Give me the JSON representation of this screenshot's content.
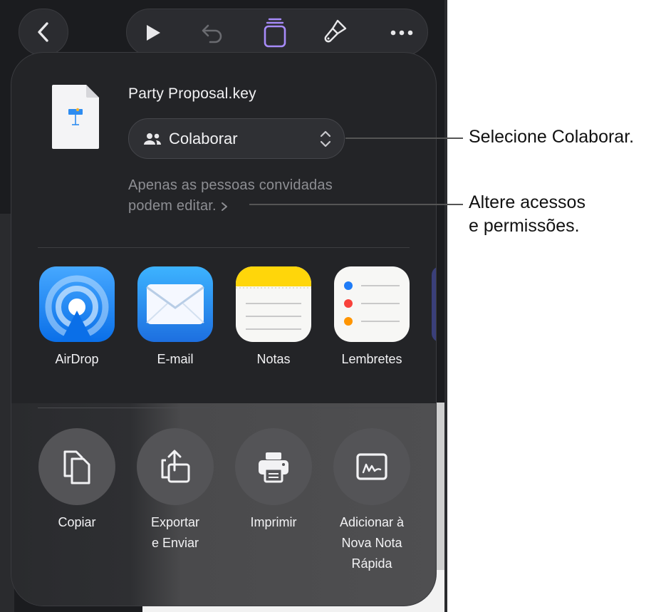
{
  "file": {
    "name": "Party Proposal.key"
  },
  "collaborate": {
    "label": "Colaborar"
  },
  "access": {
    "line1": "Apenas as pessoas convidadas",
    "line2": "podem editar."
  },
  "apps": [
    {
      "label": "AirDrop",
      "icon": "airdrop-icon"
    },
    {
      "label": "E-mail",
      "icon": "mail-icon"
    },
    {
      "label": "Notas",
      "icon": "notes-icon"
    },
    {
      "label": "Lembretes",
      "icon": "reminders-icon"
    }
  ],
  "actions": [
    {
      "line1": "Copiar",
      "line2": "",
      "line3": "",
      "icon": "copy-icon"
    },
    {
      "line1": "Exportar",
      "line2": "e Enviar",
      "line3": "",
      "icon": "export-icon"
    },
    {
      "line1": "Imprimir",
      "line2": "",
      "line3": "",
      "icon": "print-icon"
    },
    {
      "line1": "Adicionar à",
      "line2": "Nova Nota",
      "line3": "Rápida",
      "icon": "quick-note-icon"
    }
  ],
  "callouts": {
    "select_collaborate": "Selecione Colaborar.",
    "change_access_line1": "Altere acessos",
    "change_access_line2": "e permissões."
  },
  "colors": {
    "accent_purple": "#a78bfa",
    "airdrop_blue": "#1e88ff",
    "mail_blue": "#2196f3",
    "notes_yellow": "#ffd60a"
  }
}
